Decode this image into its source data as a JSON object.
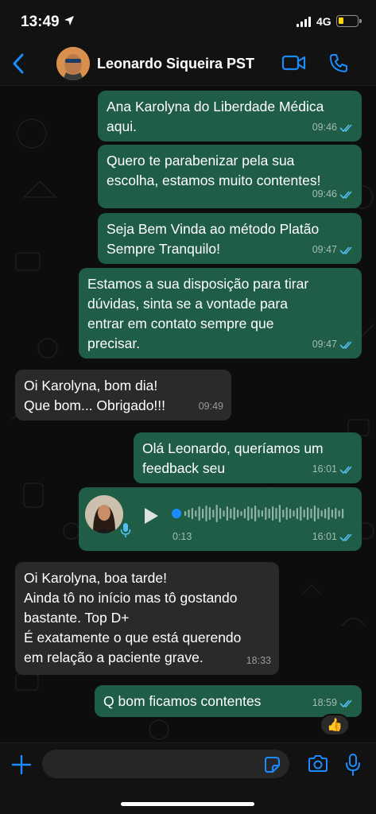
{
  "status": {
    "time": "13:49",
    "network": "4G"
  },
  "header": {
    "contact_name": "Leonardo Siqueira PST"
  },
  "messages": [
    {
      "dir": "out",
      "text": "Ana Karolyna do Liberdade Médica\naqui.",
      "time": "09:46"
    },
    {
      "dir": "out",
      "text": "Quero te parabenizar pela sua\nescolha, estamos muito contentes!",
      "time": "09:46"
    },
    {
      "dir": "out",
      "text": "Seja Bem Vinda ao método Platão\nSempre Tranquilo!",
      "time": "09:47"
    },
    {
      "dir": "out",
      "text": "Estamos a sua disposição para tirar\ndúvidas, sinta se a vontade para\nentrar em contato sempre que\nprecisar.",
      "time": "09:47"
    },
    {
      "dir": "in",
      "text": "Oi Karolyna, bom dia!\nQue bom... Obrigado!!!",
      "time": "09:49"
    },
    {
      "dir": "out",
      "text": "Olá Leonardo, queríamos um\nfeedback seu",
      "time": "16:01"
    },
    {
      "dir": "in",
      "text": "Oi Karolyna, boa tarde!\nAinda tô no início mas tô gostando\nbastante. Top D+\nÉ exatamente o que está querendo\nem relação a paciente grave.",
      "time": "18:33"
    },
    {
      "dir": "out",
      "text": "Q bom ficamos contentes",
      "time": "18:59"
    }
  ],
  "voice_message": {
    "duration": "0:13",
    "time": "16:01",
    "progress": 0
  },
  "reaction": {
    "emoji": "👍"
  },
  "input": {
    "placeholder": ""
  },
  "colors": {
    "accent": "#1a8cff",
    "outgoing_bubble": "#1f5d46",
    "incoming_bubble": "#2a2a2a",
    "read_ticks": "#53bdeb"
  }
}
